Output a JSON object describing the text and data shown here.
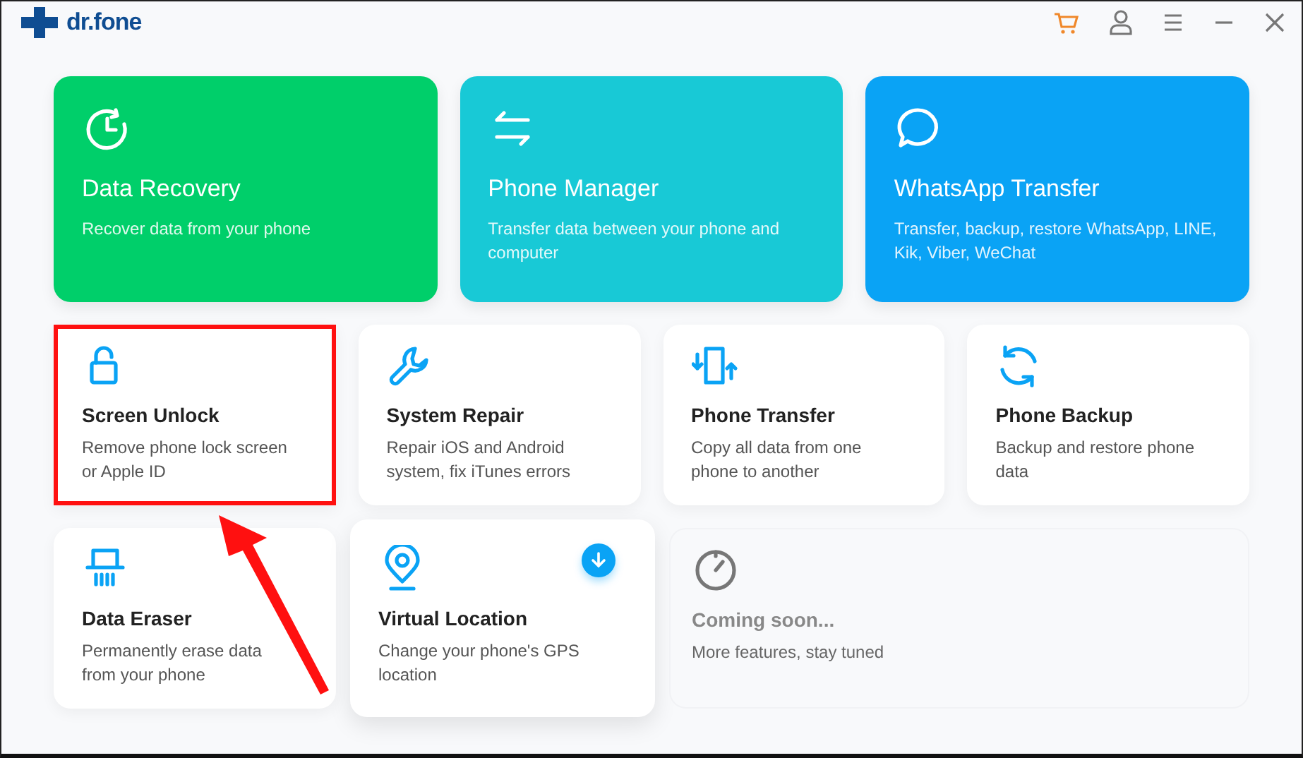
{
  "app": {
    "logo_text": "dr.fone"
  },
  "cards": [
    {
      "kind": "featured",
      "color": "#00cf6a",
      "title": "Data Recovery",
      "description": "Recover data from your phone"
    },
    {
      "kind": "featured",
      "color": "#18c9d6",
      "title": "Phone Manager",
      "description": "Transfer data between your phone and computer"
    },
    {
      "kind": "featured",
      "color": "#0aa3f5",
      "title": "WhatsApp Transfer",
      "description": "Transfer, backup, restore WhatsApp, LINE, Kik, Viber, WeChat"
    },
    {
      "kind": "tool",
      "title": "Screen Unlock",
      "description": "Remove phone lock screen or Apple ID",
      "highlighted": true
    },
    {
      "kind": "tool",
      "title": "System Repair",
      "description": "Repair iOS and Android system, fix iTunes errors",
      "highlighted": false
    },
    {
      "kind": "tool",
      "title": "Phone Transfer",
      "description": "Copy all data from one phone to another",
      "highlighted": false
    },
    {
      "kind": "tool",
      "title": "Phone Backup",
      "description": "Backup and restore phone data",
      "highlighted": false
    },
    {
      "kind": "tool",
      "title": "Data Eraser",
      "description": "Permanently erase data from your phone",
      "highlighted": false
    },
    {
      "kind": "tool",
      "title": "Virtual Location",
      "description": "Change your phone's GPS location",
      "highlighted": false,
      "hovered": true,
      "download_badge": true
    },
    {
      "kind": "placeholder",
      "title": "Coming soon...",
      "description": "More features, stay tuned"
    }
  ],
  "annotation_arrow": true
}
